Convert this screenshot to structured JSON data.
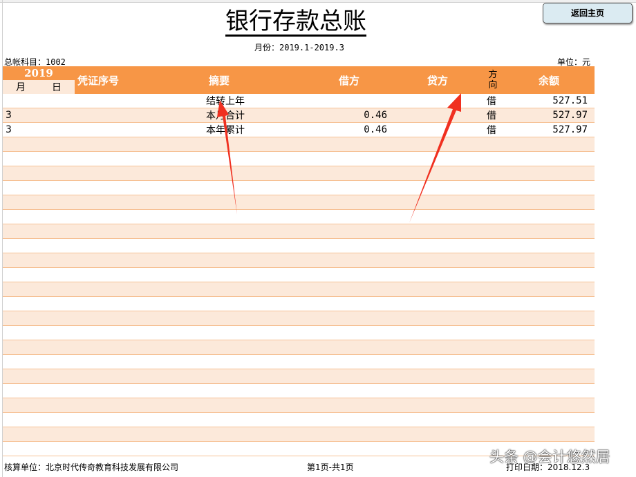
{
  "title": "银行存款总账",
  "period": "月份：2019.1-2019.3",
  "account": "总帐科目：1002",
  "unit": "单位：元",
  "home_button": "返回主页",
  "header": {
    "year": "2019",
    "month": "月",
    "day": "日",
    "voucher": "凭证序号",
    "summary": "摘要",
    "debit": "借方",
    "credit": "贷方",
    "direction": "方向",
    "balance": "余额"
  },
  "rows": [
    {
      "month": "",
      "day": "",
      "voucher": "",
      "summary": "结转上年",
      "debit": "",
      "credit": "",
      "direction": "借",
      "balance": "527.51"
    },
    {
      "month": "3",
      "day": "",
      "voucher": "",
      "summary": "本月合计",
      "debit": "0.46",
      "credit": "",
      "direction": "借",
      "balance": "527.97"
    },
    {
      "month": "3",
      "day": "",
      "voucher": "",
      "summary": "本年累计",
      "debit": "0.46",
      "credit": "",
      "direction": "借",
      "balance": "527.97"
    }
  ],
  "empty_rows": 22,
  "footer": {
    "company": "核算单位：北京时代传奇教育科技发展有限公司",
    "page": "第1页-共1页",
    "print_date": "打印日期：2018.12.3"
  },
  "watermark": "头条 @会计悠然居",
  "colors": {
    "header": "#f79646",
    "alt_row": "#fce9da",
    "arrow": "#f03020"
  }
}
